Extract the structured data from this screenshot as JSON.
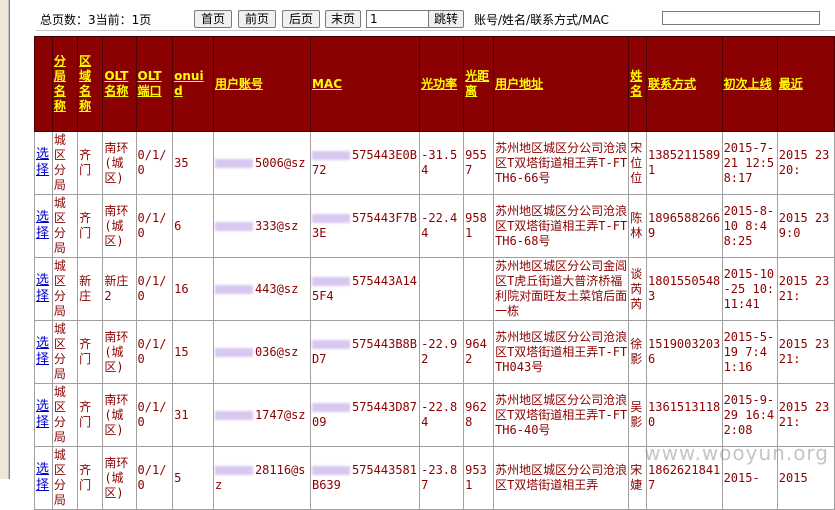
{
  "pager": {
    "info": "总页数：3当前：1页",
    "first": "首页",
    "prev": "前页",
    "next": "后页",
    "last": "末页",
    "page_select": "1",
    "go": "跳转",
    "search_label": "账号/姓名/联系方式/MAC",
    "search_value": ""
  },
  "table": {
    "headers": [
      "",
      "分局名称",
      "区域名称",
      "OLT名称",
      "OLT端口",
      "onuid",
      "用户账号",
      "MAC",
      "光功率",
      "光距离",
      "用户地址",
      "姓名",
      "联系方式",
      "初次上线",
      "最近"
    ],
    "rows": [
      {
        "action": "选择",
        "branch": "城区分局",
        "area": "齐门",
        "olt": "南环(城区)",
        "port": "0/1/0",
        "onuid": "35",
        "account": "5006@sz",
        "mac": "575443E0B72",
        "power": "-31.54",
        "distance": "9557",
        "address": "苏州地区城区分公司沧浪区T双塔街道相王弄T-FTTH6-66号",
        "name": "宋位位",
        "phone": "13852115891",
        "first_online": "2015-7-21 12:58:17",
        "latest": "2015 23 20:"
      },
      {
        "action": "选择",
        "branch": "城区分局",
        "area": "齐门",
        "olt": "南环(城区)",
        "port": "0/1/0",
        "onuid": "6",
        "account": "333@sz",
        "mac": "575443F7B3E",
        "power": "-22.44",
        "distance": "9581",
        "address": "苏州地区城区分公司沧浪区T双塔街道相王弄T-FTTH6-68号",
        "name": "陈林",
        "phone": "18965882669",
        "first_online": "2015-8-10 8:48:25",
        "latest": "2015 23 9:0"
      },
      {
        "action": "选择",
        "branch": "城区分局",
        "area": "新庄",
        "olt": "新庄2",
        "port": "0/1/0",
        "onuid": "16",
        "account": "443@sz",
        "mac": "575443A145F4",
        "power": "",
        "distance": "",
        "address": "苏州地区城区分公司金阊区T虎丘街道大普济桥福利院对面旺友土菜馆后面一栋",
        "name": "谈芮芮",
        "phone": "18015505483",
        "first_online": "2015-10-25 10:11:41",
        "latest": "2015 23 21:"
      },
      {
        "action": "选择",
        "branch": "城区分局",
        "area": "齐门",
        "olt": "南环(城区)",
        "port": "0/1/0",
        "onuid": "15",
        "account": "036@sz",
        "mac": "575443B8BD7",
        "power": "-22.92",
        "distance": "9642",
        "address": "苏州地区城区分公司沧浪区T双塔街道相王弄T-FTTH043号",
        "name": "徐影",
        "phone": "15190032036",
        "first_online": "2015-5-19 7:41:16",
        "latest": "2015 23 21:"
      },
      {
        "action": "选择",
        "branch": "城区分局",
        "area": "齐门",
        "olt": "南环(城区)",
        "port": "0/1/0",
        "onuid": "31",
        "account": "1747@sz",
        "mac": "575443D8709",
        "power": "-22.84",
        "distance": "9628",
        "address": "苏州地区城区分公司沧浪区T双塔街道相王弄T-FTTH6-40号",
        "name": "吴影",
        "phone": "13615131180",
        "first_online": "2015-9-29 16:42:08",
        "latest": "2015 23 21:"
      },
      {
        "action": "选择",
        "branch": "城区分局",
        "area": "齐门",
        "olt": "南环(城区)",
        "port": "0/1/0",
        "onuid": "5",
        "account": "28116@sz",
        "mac": "575443581B639",
        "power": "-23.87",
        "distance": "9531",
        "address": "苏州地区城区分公司沧浪区T双塔街道相王弄",
        "name": "宋婕",
        "phone": "18626218417",
        "first_online": "2015-",
        "latest": "2015"
      }
    ]
  },
  "watermark": "www.wooyun.org"
}
